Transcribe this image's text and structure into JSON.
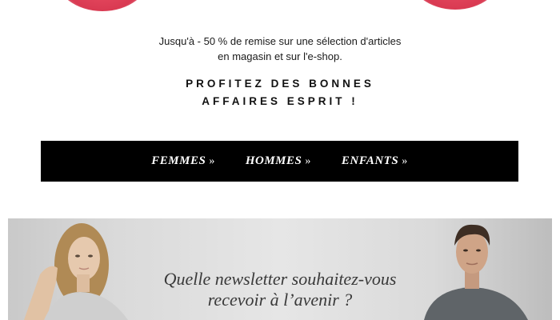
{
  "promo": {
    "line1": "Jusqu'à - 50 % de remise sur une sélection d'articles",
    "line2": "en magasin et sur l'e-shop."
  },
  "headline": {
    "line1": "PROFITEZ DES BONNES",
    "line2": "AFFAIRES ESPRIT !"
  },
  "nav": {
    "items": [
      {
        "label": "FEMMES",
        "chevron": "»"
      },
      {
        "label": "HOMMES",
        "chevron": "»"
      },
      {
        "label": "ENFANTS",
        "chevron": "»"
      }
    ]
  },
  "banner": {
    "line1": "Quelle newsletter souhaitez-vous",
    "line2": "recevoir à l’avenir ?"
  },
  "colors": {
    "accent_blob": "#e4475e",
    "nav_background": "#000000",
    "nav_text": "#ffffff",
    "banner_text": "#3a3a3a"
  }
}
